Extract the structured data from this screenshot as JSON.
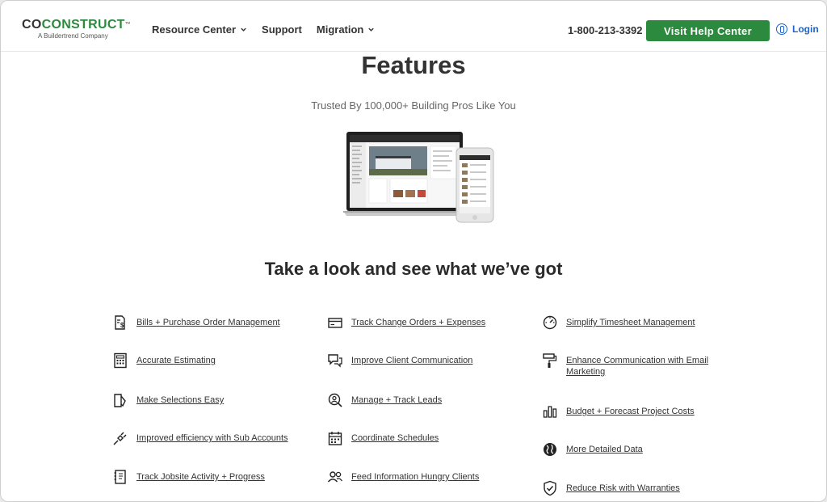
{
  "header": {
    "logo": {
      "main_dark": "CO",
      "main_green": "CONSTRUCT",
      "tm": "™",
      "sub": "A Buildertrend Company"
    },
    "nav": [
      {
        "label": "Resource Center",
        "dropdown": true
      },
      {
        "label": "Support",
        "dropdown": false
      },
      {
        "label": "Migration",
        "dropdown": true
      }
    ],
    "phone": "1-800-213-3392",
    "cta_label": "Visit Help Center",
    "login_label": "Login"
  },
  "hero": {
    "title": "Features",
    "subtitle": "Trusted By 100,000+ Building Pros Like You"
  },
  "section_title": "Take a look and see what we’ve got",
  "features": {
    "col1": [
      {
        "label": "Bills + Purchase Order Management",
        "icon": "bill-dollar-icon"
      },
      {
        "label": "Accurate Estimating",
        "icon": "calculator-icon"
      },
      {
        "label": "Make Selections Easy",
        "icon": "document-pen-icon"
      },
      {
        "label": "Improved efficiency with Sub Accounts",
        "icon": "plug-icon"
      },
      {
        "label": "Track Jobsite Activity + Progress",
        "icon": "notebook-icon"
      }
    ],
    "col2": [
      {
        "label": "Track Change Orders + Expenses",
        "icon": "credit-card-icon"
      },
      {
        "label": "Improve Client Communication",
        "icon": "chat-bubbles-icon"
      },
      {
        "label": "Manage + Track Leads",
        "icon": "user-search-icon"
      },
      {
        "label": "Coordinate Schedules",
        "icon": "calendar-icon"
      },
      {
        "label": "Feed Information Hungry Clients",
        "icon": "users-icon"
      }
    ],
    "col3": [
      {
        "label": "Simplify Timesheet Management",
        "icon": "clock-gauge-icon"
      },
      {
        "label": "Enhance Communication with Email Marketing",
        "icon": "paint-roller-icon"
      },
      {
        "label": "Budget + Forecast Project Costs",
        "icon": "bar-chart-icon"
      },
      {
        "label": "More Detailed Data",
        "icon": "globe-icon"
      },
      {
        "label": "Reduce Risk with Warranties",
        "icon": "shield-check-icon"
      }
    ]
  },
  "colors": {
    "brand_green": "#2b8a3e",
    "link_blue": "#1e63c7",
    "text": "#333333"
  }
}
